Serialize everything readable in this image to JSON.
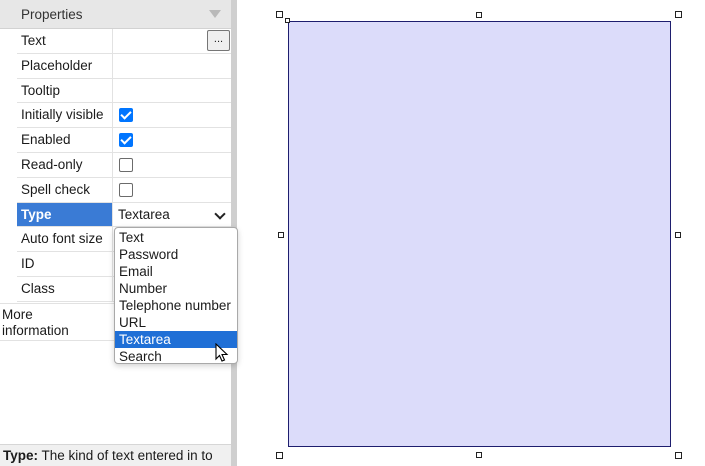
{
  "panel": {
    "title": "Properties",
    "rows": [
      {
        "label": "Text",
        "button": "..."
      },
      {
        "label": "Placeholder"
      },
      {
        "label": "Tooltip"
      },
      {
        "label": "Initially visible",
        "checked": true
      },
      {
        "label": "Enabled",
        "checked": true
      },
      {
        "label": "Read-only",
        "checked": false
      },
      {
        "label": "Spell check",
        "checked": false
      },
      {
        "label": "Type",
        "value": "Textarea"
      },
      {
        "label": "Auto font size"
      },
      {
        "label": "ID"
      },
      {
        "label": "Class"
      }
    ],
    "more_information": "More information",
    "help": {
      "term": "Type:",
      "text": " The kind of text entered in to"
    }
  },
  "dropdown": {
    "options": [
      "Text",
      "Password",
      "Email",
      "Number",
      "Telephone number",
      "URL",
      "Textarea",
      "Search"
    ],
    "highlighted": "Textarea"
  },
  "colors": {
    "selected_row": "#3a7bd5",
    "option_highlight": "#1f6fd6",
    "checkbox": "#0075ff",
    "shape_fill": "#dcdcfa",
    "shape_border": "#1e1e6e"
  }
}
